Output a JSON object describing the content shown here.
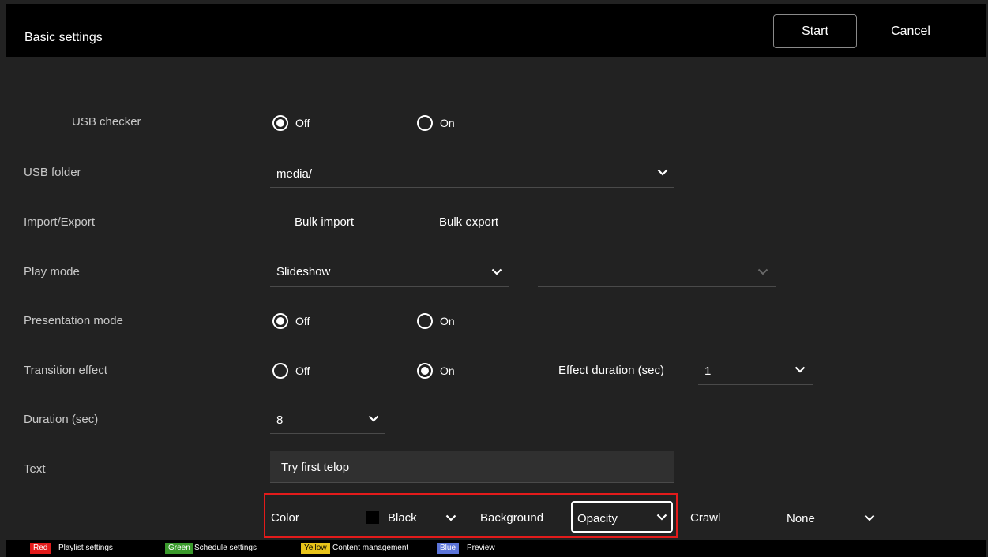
{
  "header": {
    "title": "Basic settings",
    "start_label": "Start",
    "cancel_label": "Cancel"
  },
  "usb_checker": {
    "label": "USB checker",
    "off": "Off",
    "on": "On",
    "selected": "Off"
  },
  "usb_folder": {
    "label": "USB folder",
    "value": "media/"
  },
  "import_export": {
    "label": "Import/Export",
    "bulk_import": "Bulk import",
    "bulk_export": "Bulk export"
  },
  "play_mode": {
    "label": "Play mode",
    "value": "Slideshow",
    "secondary_value": ""
  },
  "presentation_mode": {
    "label": "Presentation mode",
    "off": "Off",
    "on": "On",
    "selected": "Off"
  },
  "transition_effect": {
    "label": "Transition effect",
    "off": "Off",
    "on": "On",
    "selected": "On",
    "duration_label": "Effect duration (sec)",
    "duration_value": "1"
  },
  "duration": {
    "label": "Duration (sec)",
    "value": "8"
  },
  "text": {
    "label": "Text",
    "value": "Try first telop"
  },
  "telop_row": {
    "color_label": "Color",
    "color_value": "Black",
    "color_swatch": "#000000",
    "background_label": "Background",
    "background_value": "Opacity",
    "crawl_label": "Crawl",
    "crawl_value": "None"
  },
  "footer": {
    "red_key": "Red",
    "red_text": "Playlist settings",
    "green_key": "Green",
    "green_text": "Schedule settings",
    "yellow_key": "Yellow",
    "yellow_text": "Content management",
    "blue_key": "Blue",
    "blue_text": "Preview"
  },
  "colors": {
    "red": "#e31b1b",
    "green": "#3a9a2c",
    "yellow": "#e8c41a",
    "blue": "#5b74d9",
    "highlight": "#e31b1b"
  }
}
